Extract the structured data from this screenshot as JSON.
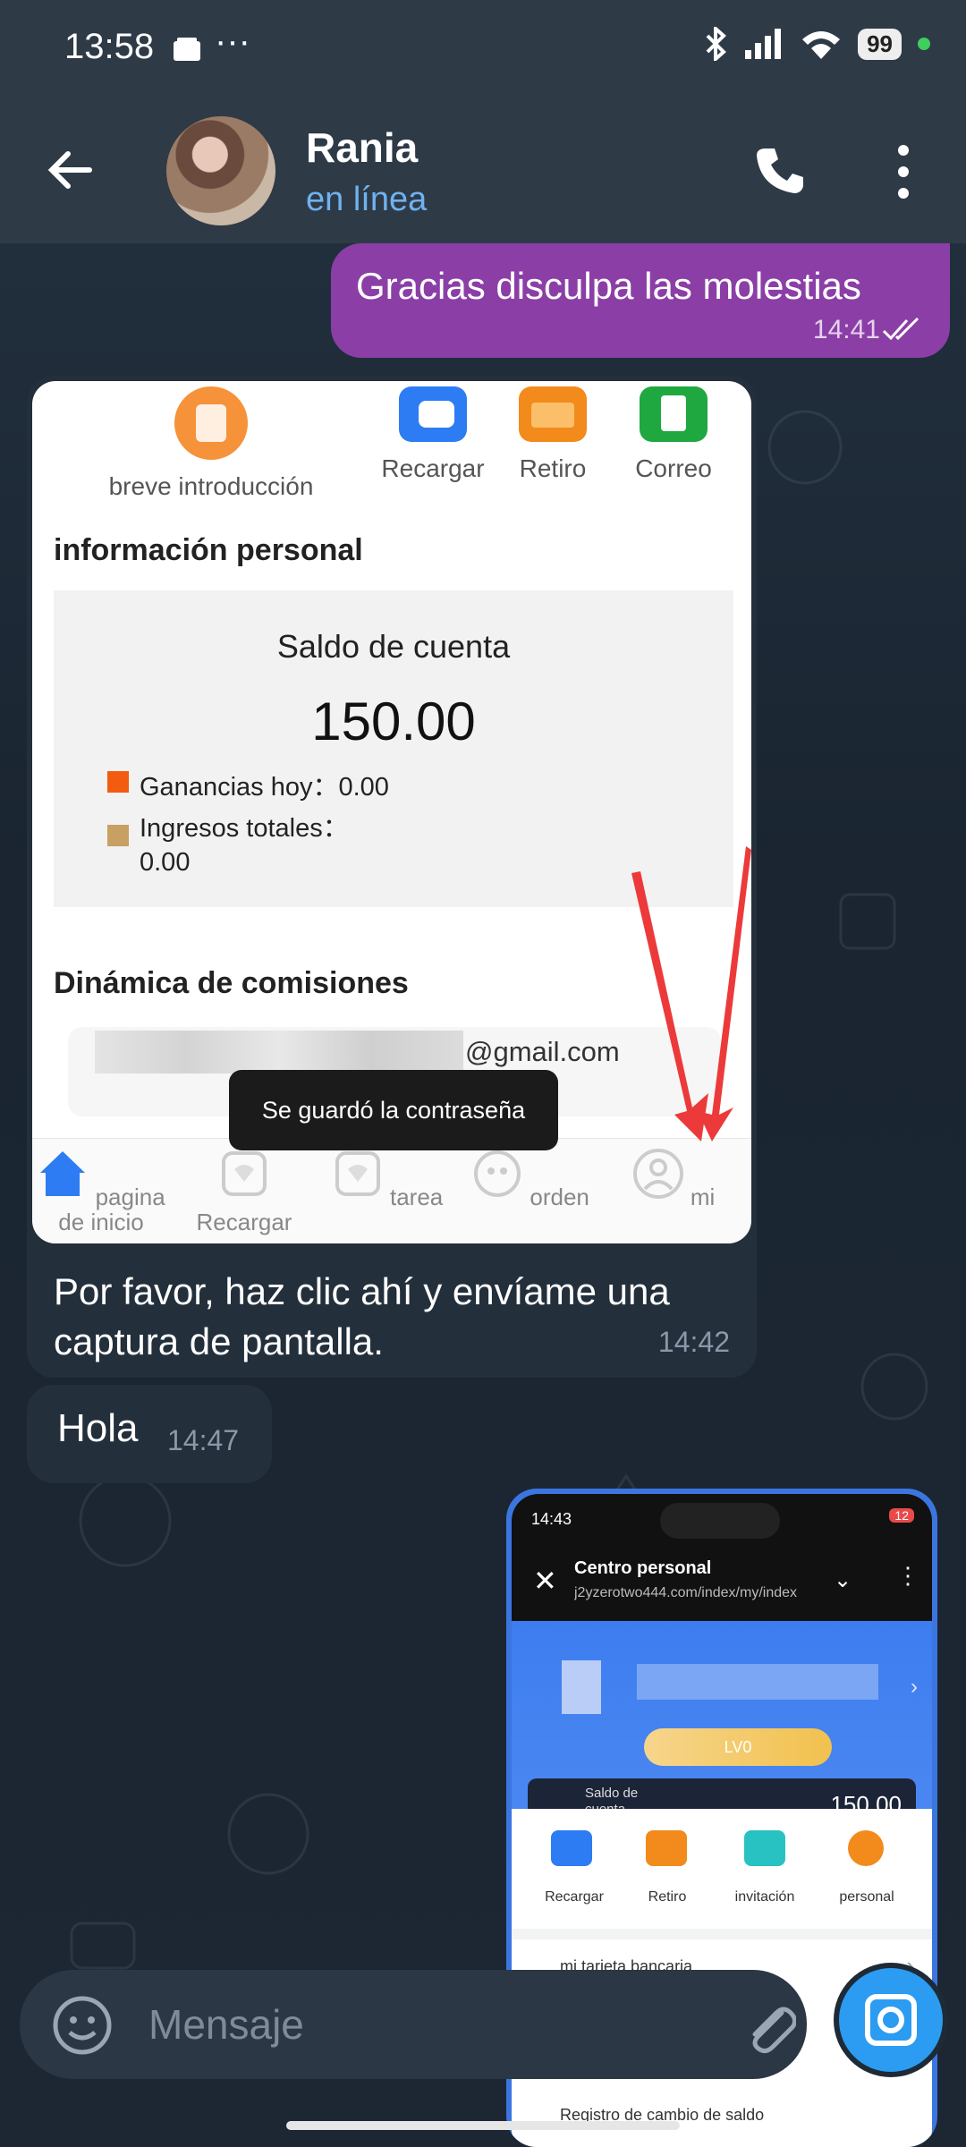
{
  "status_bar": {
    "time": "13:58",
    "battery": "99"
  },
  "header": {
    "contact_name": "Rania",
    "status": "en línea"
  },
  "messages": [
    {
      "direction": "out",
      "text": "Gracias disculpa las molestias",
      "time": "14:41"
    },
    {
      "direction": "in",
      "text": "Por favor, haz clic ahí y envíame una captura de pantalla.",
      "time": "14:42"
    },
    {
      "direction": "in",
      "text": "Hola",
      "time": "14:47"
    }
  ],
  "screenshot1": {
    "top_icons": [
      "breve introducción",
      "Recargar",
      "Retiro",
      "Correo"
    ],
    "section_title": "información personal",
    "card_title": "Saldo de cuenta",
    "balance": "150.00",
    "earnings_today_label": "Ganancias hoy：0.00",
    "total_income_label": "Ingresos totales：",
    "total_income_value": "0.00",
    "commissions_title": "Dinámica de comisiones",
    "email_suffix": "@gmail.com",
    "toast": "Se guardó la contraseña",
    "nav": [
      "pagina de inicio",
      "Recargar",
      "tarea",
      "orden",
      "mi"
    ]
  },
  "screenshot2": {
    "time": "14:43",
    "battery": "12",
    "title": "Centro personal",
    "url": "j2yzerotwo444.com/index/my/index",
    "level": "LV0",
    "balance_label": "Saldo de cuenta",
    "balance": "150.00",
    "icons": [
      "Recargar",
      "Retiro",
      "invitación",
      "personal"
    ],
    "menu_items": [
      "mi tarjeta bancaria",
      "Registro de cambio de saldo"
    ]
  },
  "composer": {
    "placeholder": "Mensaje"
  }
}
